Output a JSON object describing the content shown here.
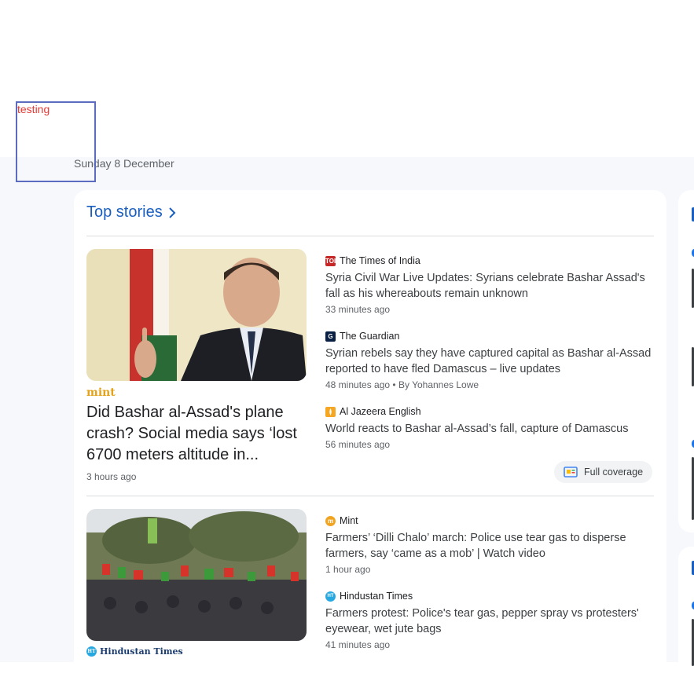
{
  "overlay": {
    "label": "testing"
  },
  "date": "Sunday 8 December",
  "section": {
    "title": "Top stories"
  },
  "cluster1": {
    "source_logo": "mint",
    "headline": "Did Bashar al-Assad's plane crash? Social media says ‘lost 6700 meters altitude in...",
    "time": "3 hours ago",
    "stories": [
      {
        "source": "The Times of India",
        "icon_text": "TOI",
        "title": "Syria Civil War Live Updates: Syrians celebrate Bashar Assad's fall as his whereabouts remain unknown",
        "meta": "33 minutes ago"
      },
      {
        "source": "The Guardian",
        "icon_text": "G",
        "title": "Syrian rebels say they have captured capital as Bashar al-Assad reported to have fled Damascus – live updates",
        "meta": "48 minutes ago",
        "author": "By Yohannes Lowe"
      },
      {
        "source": "Al Jazeera English",
        "icon_text": "",
        "title": "World reacts to Bashar al-Assad’s fall, capture of Damascus",
        "meta": "56 minutes ago"
      }
    ],
    "full_coverage": "Full coverage"
  },
  "cluster2": {
    "source_logo": "Hindustan Times",
    "stories": [
      {
        "source": "Mint",
        "icon_text": "m",
        "title": "Farmers’ ‘Dilli Chalo’ march: Police use tear gas to disperse farmers, say ‘came as a mob’ | Watch video",
        "meta": "1 hour ago"
      },
      {
        "source": "Hindustan Times",
        "icon_text": "HT",
        "title": "Farmers protest: Police's tear gas, pepper spray vs protesters' eyewear, wet jute bags",
        "meta": "41 minutes ago"
      }
    ]
  },
  "colors": {
    "accent": "#1a5fbf",
    "overlay_border": "#5b6bbf",
    "overlay_text": "#e53935",
    "mint": "#e3a21a",
    "background": "#f6f8fc"
  },
  "icons": [
    "chevron-right-icon",
    "full-coverage-icon",
    "times-of-india-icon",
    "guardian-icon",
    "al-jazeera-icon",
    "mint-icon",
    "hindustan-times-icon"
  ]
}
